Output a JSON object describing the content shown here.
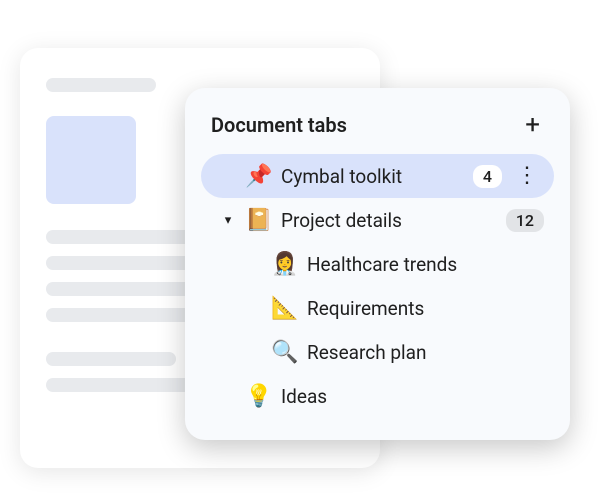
{
  "panel": {
    "title": "Document tabs",
    "tabs": [
      {
        "icon": "📌",
        "label": "Cymbal toolkit",
        "badge": "4",
        "selected": true,
        "has_more": true
      },
      {
        "icon": "📔",
        "label": "Project details",
        "badge": "12",
        "expanded": true,
        "children": [
          {
            "icon": "👩‍⚕️",
            "label": "Healthcare trends"
          },
          {
            "icon": "📐",
            "label": "Requirements"
          },
          {
            "icon": "🔍",
            "label": "Research plan"
          }
        ]
      },
      {
        "icon": "💡",
        "label": "Ideas"
      }
    ]
  }
}
